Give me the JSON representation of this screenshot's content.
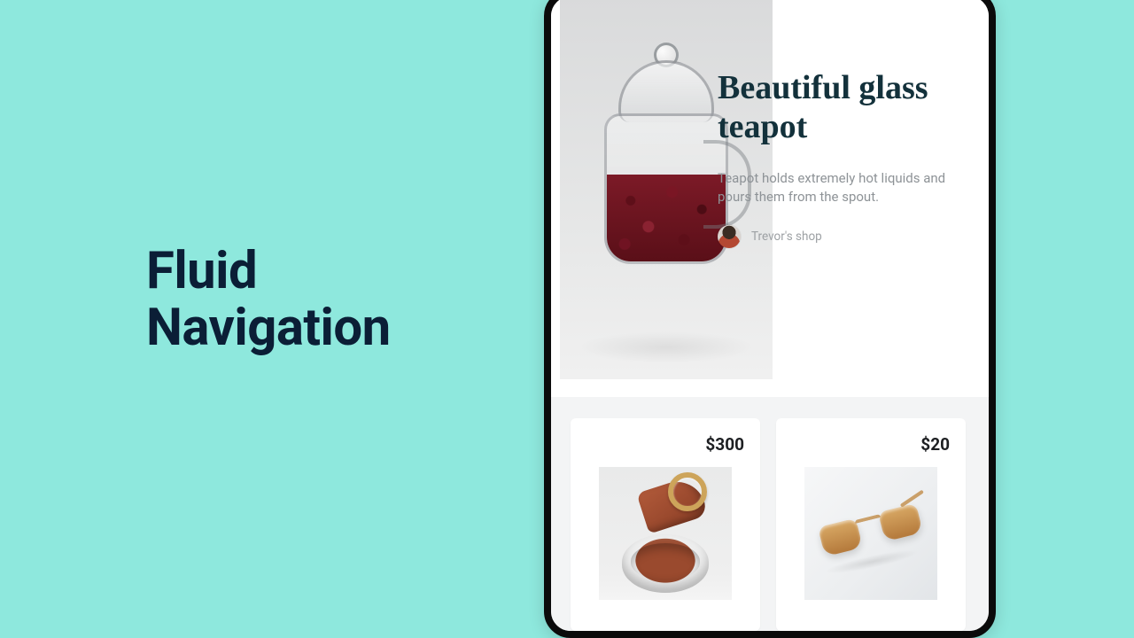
{
  "headline": {
    "line1": "Fluid",
    "line2": "Navigation"
  },
  "hero": {
    "title": "Beautiful glass teapot",
    "description": "Teapot holds extremely hot liquids and pours them from the spout.",
    "shop_name": "Trevor's shop"
  },
  "products": [
    {
      "price": "$300",
      "name": "leather-belt"
    },
    {
      "price": "$20",
      "name": "sunglasses"
    }
  ]
}
